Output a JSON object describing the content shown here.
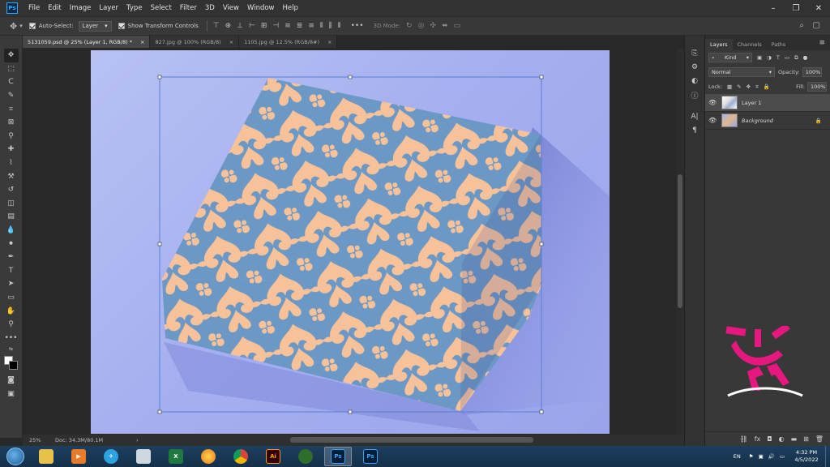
{
  "app": {
    "logo_text": "Ps"
  },
  "menu": [
    "File",
    "Edit",
    "Image",
    "Layer",
    "Type",
    "Select",
    "Filter",
    "3D",
    "View",
    "Window",
    "Help"
  ],
  "options": {
    "auto_select_label": "Auto-Select:",
    "auto_select_value": "Layer",
    "show_transform_label": "Show Transform Controls",
    "mode_3d_label": "3D Mode:"
  },
  "tabs": [
    {
      "label": "5131059.psd @ 25% (Layer 1, RGB/8) *"
    },
    {
      "label": "827.jpg @ 100% (RGB/8)"
    },
    {
      "label": "1105.jpg @ 12.5% (RGB/8#)"
    }
  ],
  "status": {
    "zoom": "25%",
    "doc": "Doc: 34.3M/80.1M"
  },
  "layers_panel": {
    "tabs": [
      "Layers",
      "Channels",
      "Paths"
    ],
    "kind_label": "Kind",
    "blend_mode": "Normal",
    "opacity_label": "Opacity:",
    "opacity_value": "100%",
    "lock_label": "Lock:",
    "fill_label": "Fill:",
    "fill_value": "100%",
    "layers": [
      {
        "name": "Layer 1",
        "selected": true
      },
      {
        "name": "Background",
        "selected": false
      }
    ]
  },
  "taskbar": {
    "apps": [
      {
        "name": "explorer",
        "glyph": "",
        "color": "#e8c14a"
      },
      {
        "name": "media",
        "glyph": "▶",
        "color": "#e87a2a"
      },
      {
        "name": "telegram",
        "glyph": "✈",
        "color": "#2aa3e0"
      },
      {
        "name": "notepad",
        "glyph": "",
        "color": "#cfd8e0"
      },
      {
        "name": "excel",
        "glyph": "X",
        "color": "#1f7a3f"
      },
      {
        "name": "firefox",
        "glyph": "",
        "color": "#f07a1e"
      },
      {
        "name": "chrome",
        "glyph": "",
        "color": "#e0a92a"
      },
      {
        "name": "illustrator",
        "glyph": "Ai",
        "color": "#330000"
      },
      {
        "name": "tool",
        "glyph": "",
        "color": "#2f6d2a"
      },
      {
        "name": "photoshop-active",
        "glyph": "Ps",
        "color": "#001e36"
      },
      {
        "name": "photoshop",
        "glyph": "Ps",
        "color": "#001e36"
      }
    ],
    "language": "EN",
    "time": "4:32 PM",
    "date": "4/5/2022"
  },
  "colors": {
    "accent_ps": "#31a8ff",
    "pattern_blue": "#6b98c4",
    "pattern_peach": "#f7c29a",
    "watermark": "#e6177e"
  }
}
